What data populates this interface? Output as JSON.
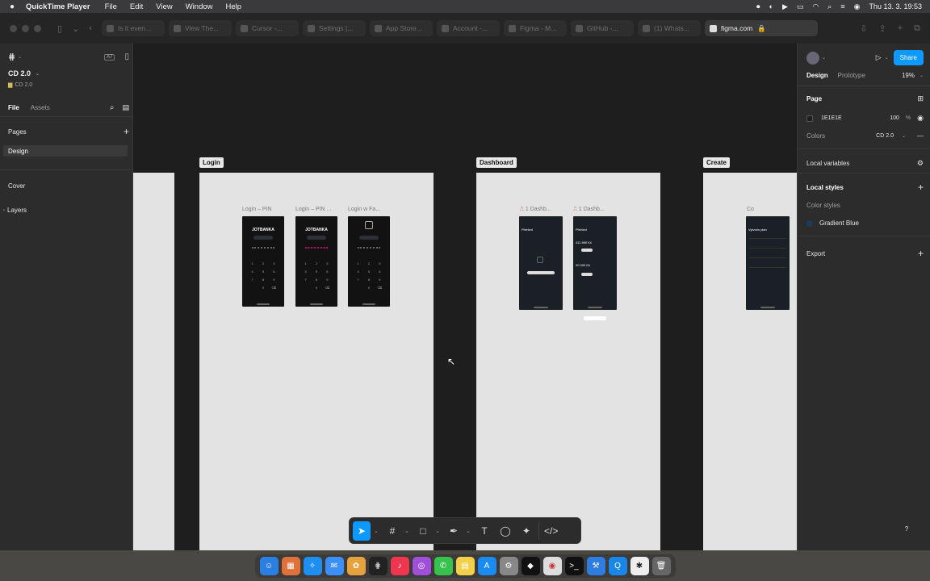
{
  "menubar": {
    "app_name": "QuickTime Player",
    "items": [
      "File",
      "Edit",
      "View",
      "Window",
      "Help"
    ],
    "clock": "Thu 13. 3.  19:53"
  },
  "browser": {
    "tabs": [
      {
        "label": "Is it even..."
      },
      {
        "label": "View The..."
      },
      {
        "label": "Cursor -..."
      },
      {
        "label": "Settings |..."
      },
      {
        "label": "App Store..."
      },
      {
        "label": "Account -..."
      },
      {
        "label": "Figma - M..."
      },
      {
        "label": "GitHub -..."
      },
      {
        "label": "(1) Whats..."
      }
    ],
    "active_tab": "figma.com"
  },
  "left_panel": {
    "file_name": "CD 2.0",
    "file_sub": "CD 2.0",
    "badge": "A7",
    "tab_file": "File",
    "tab_assets": "Assets",
    "pages_header": "Pages",
    "pages": [
      "Design",
      "Cover"
    ],
    "layers_header": "Layers"
  },
  "canvas": {
    "frames": [
      "Login",
      "Dashboard",
      "Create"
    ],
    "login_screens": [
      "Login – PIN",
      "Login – PIN ...",
      "Login w Fa..."
    ],
    "dashboard_screens": [
      "1 Dashb...",
      "1 Dashb..."
    ],
    "create_screen": "Co",
    "brand": "JOTBANKA"
  },
  "right_panel": {
    "share_label": "Share",
    "tab_design": "Design",
    "tab_prototype": "Prototype",
    "zoom": "19%",
    "page_header": "Page",
    "bg_color": "1E1E1E",
    "bg_opacity": "100",
    "bg_opacity_unit": "%",
    "colors_label": "Colors",
    "colors_value": "CD 2.0",
    "local_variables": "Local variables",
    "local_styles": "Local styles",
    "color_styles": "Color styles",
    "style_name": "Gradient Blue",
    "export": "Export",
    "help": "?"
  },
  "colors": {
    "accent": "#0d99ff",
    "canvas_bg": "#1e1e1e",
    "panel_bg": "#2c2c2c",
    "frame_bg": "#e3e3e3"
  }
}
